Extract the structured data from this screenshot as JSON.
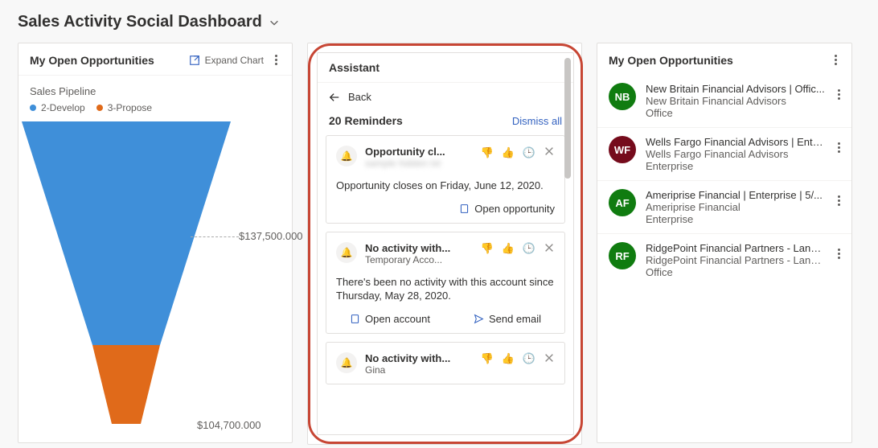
{
  "header": {
    "title": "Sales Activity Social Dashboard"
  },
  "left": {
    "title": "My Open Opportunities",
    "expand": "Expand Chart",
    "chart_title": "Sales Pipeline",
    "legend": [
      "2-Develop",
      "3-Propose"
    ],
    "val1": "$137,500.000",
    "val2": "$104,700.000"
  },
  "assist": {
    "title": "Assistant",
    "back": "Back",
    "reminders": "20 Reminders",
    "dismiss": "Dismiss all",
    "cards": [
      {
        "title": "Opportunity cl...",
        "sub_blur": "sample hidden txt",
        "body": "Opportunity closes on Friday, June 12, 2020.",
        "action1": "Open opportunity"
      },
      {
        "title": "No activity with...",
        "sub": "Temporary Acco...",
        "body": "There's been no activity with this account since Thursday, May 28, 2020.",
        "action1": "Open account",
        "action2": "Send email"
      },
      {
        "title": "No activity with...",
        "sub": "Gina"
      }
    ]
  },
  "right": {
    "title": "My Open Opportunities",
    "items": [
      {
        "initials": "NB",
        "color": "#107c10",
        "title": "New Britain Financial Advisors | Offic...",
        "line2": "New Britain Financial Advisors",
        "line3": "Office"
      },
      {
        "initials": "WF",
        "color": "#750b1c",
        "title": "Wells Fargo Financial Advisors | Enter...",
        "line2": "Wells Fargo Financial Advisors",
        "line3": "Enterprise"
      },
      {
        "initials": "AF",
        "color": "#107c10",
        "title": "Ameriprise Financial | Enterprise | 5/...",
        "line2": "Ameriprise Financial",
        "line3": "Enterprise"
      },
      {
        "initials": "RF",
        "color": "#107c10",
        "title": "RidgePoint Financial Partners - Lang...",
        "line2": "RidgePoint Financial Partners - Lang...",
        "line3": "Office"
      }
    ]
  },
  "chart_data": {
    "type": "bar",
    "title": "Sales Pipeline",
    "categories": [
      "2-Develop",
      "3-Propose"
    ],
    "values": [
      137500.0,
      104700.0
    ],
    "series": [
      {
        "name": "2-Develop",
        "values": [
          137500.0
        ],
        "color": "#3f8fd9"
      },
      {
        "name": "3-Propose",
        "values": [
          104700.0
        ],
        "color": "#e06a1a"
      }
    ],
    "xlabel": "",
    "ylabel": "",
    "ylim": [
      0,
      250000
    ]
  }
}
